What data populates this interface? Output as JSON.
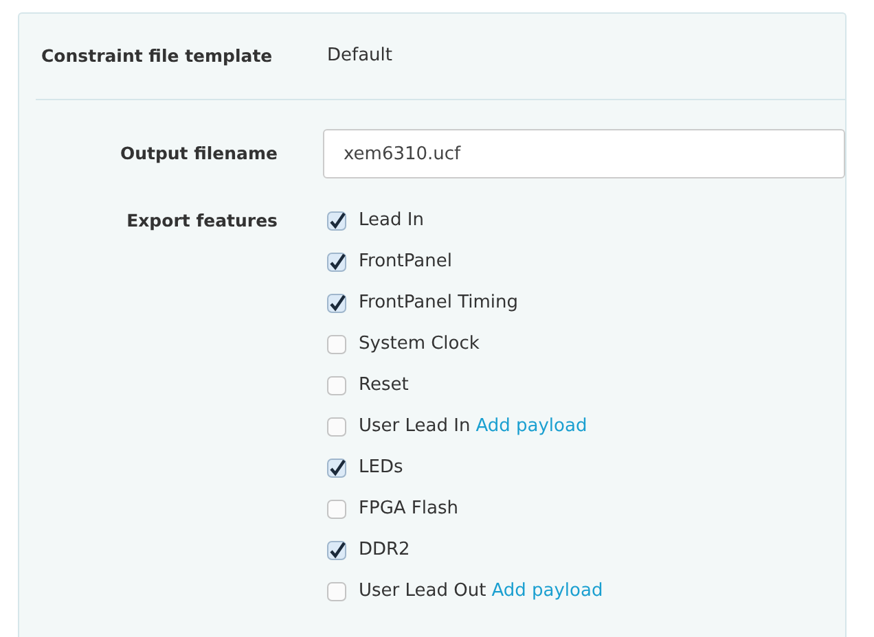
{
  "template": {
    "label": "Constraint file template",
    "value": "Default"
  },
  "output": {
    "label": "Output filename",
    "value": "xem6310.ucf"
  },
  "export": {
    "label": "Export features",
    "features": [
      {
        "label": "Lead In",
        "checked": true
      },
      {
        "label": "FrontPanel",
        "checked": true
      },
      {
        "label": "FrontPanel Timing",
        "checked": true
      },
      {
        "label": "System Clock",
        "checked": false
      },
      {
        "label": "Reset",
        "checked": false
      },
      {
        "label": "User Lead In",
        "checked": false,
        "link": "Add payload"
      },
      {
        "label": "LEDs",
        "checked": true
      },
      {
        "label": "FPGA Flash",
        "checked": false
      },
      {
        "label": "DDR2",
        "checked": true
      },
      {
        "label": "User Lead Out",
        "checked": false,
        "link": "Add payload"
      }
    ]
  }
}
